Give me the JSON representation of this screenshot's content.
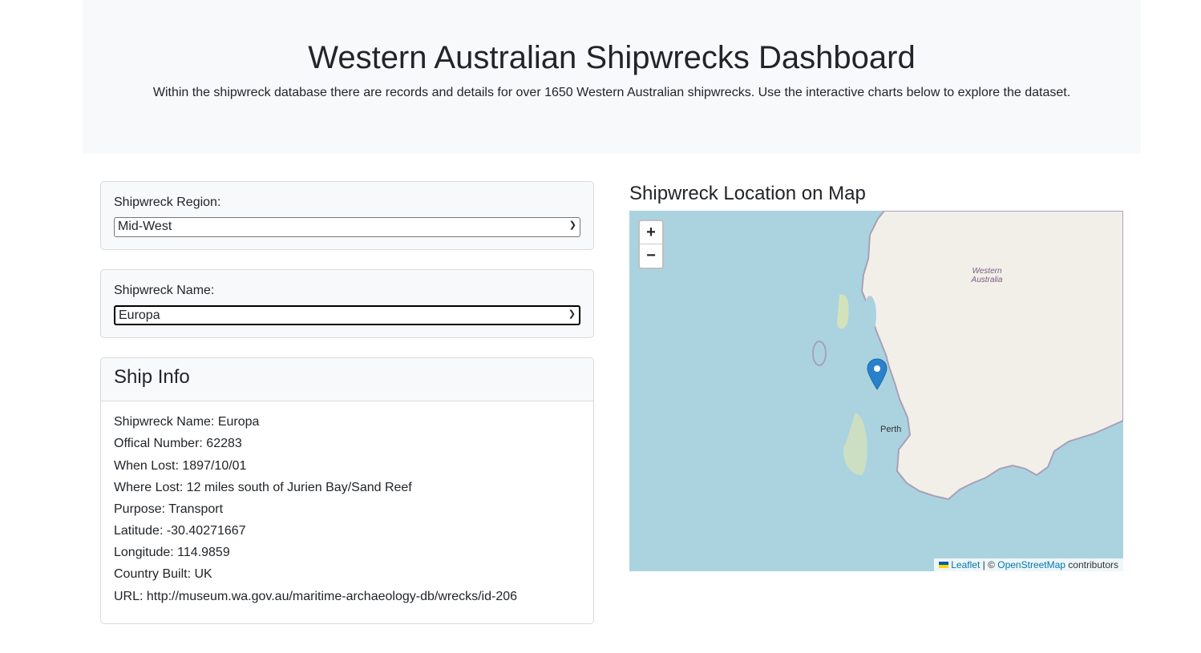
{
  "header": {
    "title": "Western Australian Shipwrecks Dashboard",
    "subtitle": "Within the shipwreck database there are records and details for over 1650 Western Australian shipwrecks. Use the interactive charts below to explore the dataset."
  },
  "region": {
    "label": "Shipwreck Region:",
    "value": "Mid-West"
  },
  "name": {
    "label": "Shipwreck Name:",
    "value": "Europa"
  },
  "info": {
    "title": "Ship Info",
    "rows": [
      "Shipwreck Name: Europa",
      "Offical Number: 62283",
      "When Lost: 1897/10/01",
      "Where Lost: 12 miles south of Jurien Bay/Sand Reef",
      "Purpose: Transport",
      "Latitude: -30.40271667",
      "Longitude: 114.9859",
      "Country Built: UK",
      "URL: http://museum.wa.gov.au/maritime-archaeology-db/wrecks/id-206"
    ]
  },
  "map": {
    "title": "Shipwreck Location on Map",
    "zoom_in": "+",
    "zoom_out": "−",
    "labels": {
      "state": "Western Australia",
      "city": "Perth"
    },
    "attribution": {
      "leaflet": "Leaflet",
      "sep": " | © ",
      "osm": "OpenStreetMap",
      "contrib": " contributors"
    },
    "marker_color": "#2a81cb"
  }
}
